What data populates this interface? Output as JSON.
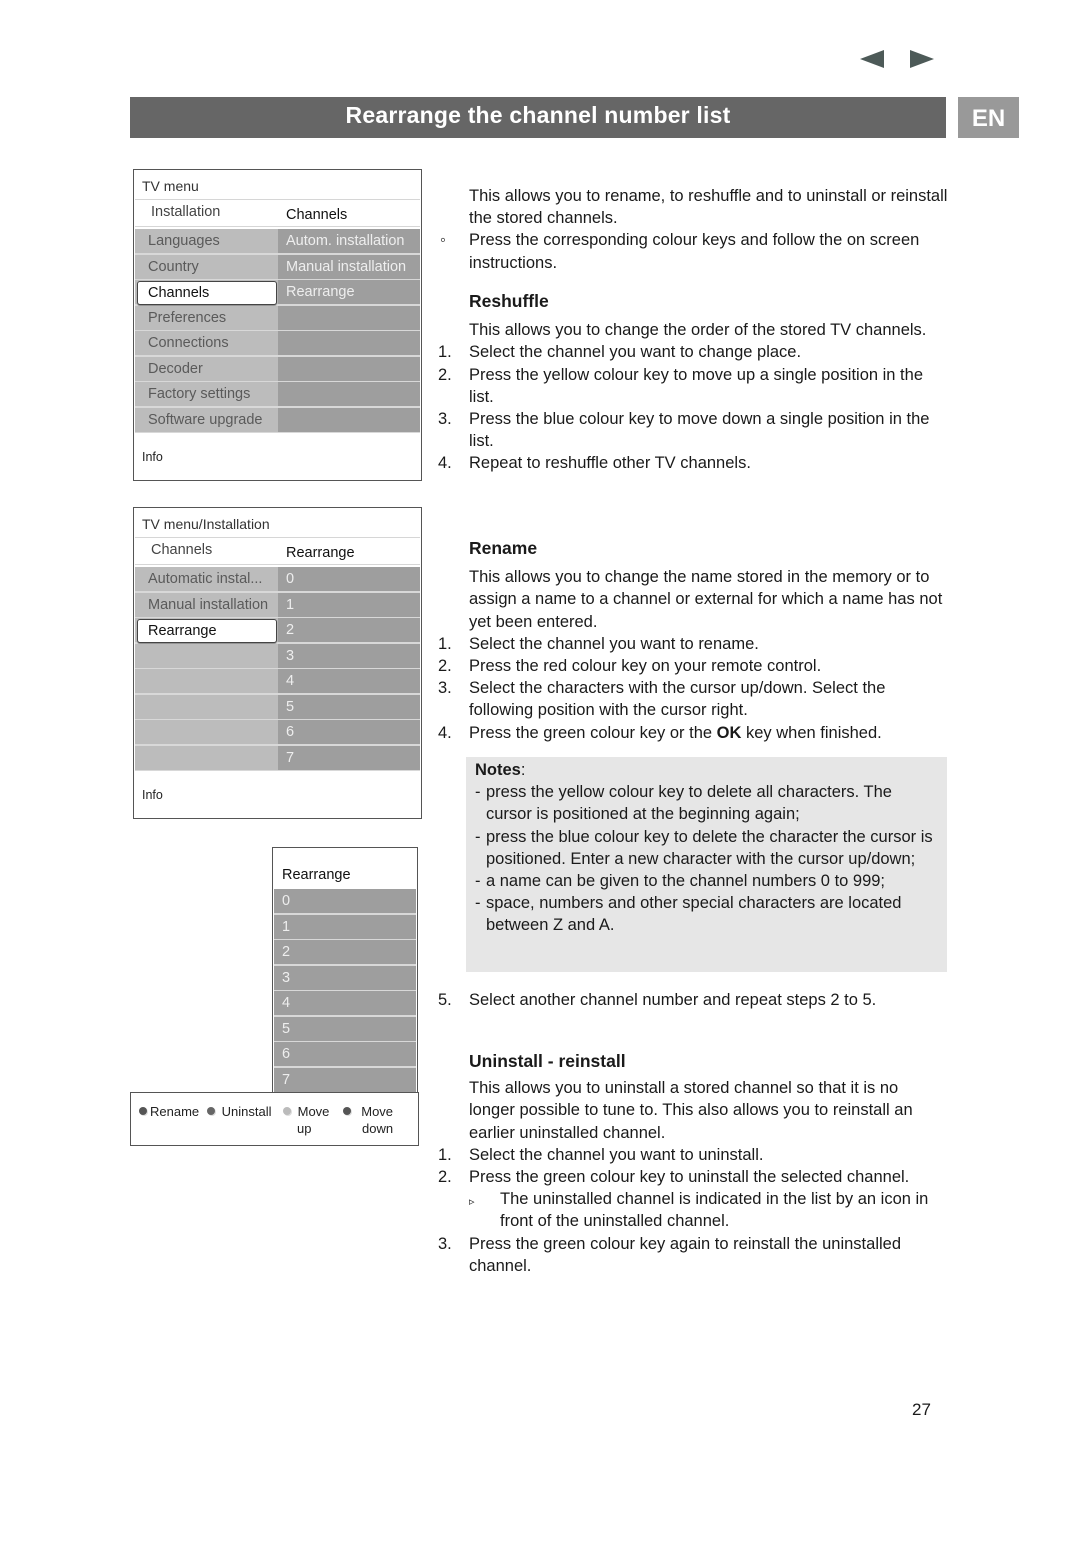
{
  "nav": {
    "prev_icon": "arrow-left-icon",
    "next_icon": "arrow-right-icon"
  },
  "header": {
    "title": "Rearrange the channel number list",
    "language": "EN"
  },
  "colors": {
    "title_bar": "#666666",
    "lang_badge": "#999999",
    "notes_bg": "#e6e6e6"
  },
  "panel1": {
    "breadcrumb": "TV menu",
    "left_header": "Installation",
    "right_header": "Channels",
    "left_items": [
      "Languages",
      "Country",
      "Channels",
      "Preferences",
      "Connections",
      "Decoder",
      "Factory settings",
      "Software upgrade"
    ],
    "right_items": [
      "Autom. installation",
      "Manual installation",
      "Rearrange",
      "",
      "",
      "",
      "",
      ""
    ],
    "selected": "Channels",
    "info": "Info"
  },
  "panel2": {
    "breadcrumb": "TV menu/Installation",
    "left_header": "Channels",
    "right_header": "Rearrange",
    "left_items": [
      "Automatic instal...",
      "Manual installation",
      "Rearrange",
      "",
      "",
      "",
      "",
      ""
    ],
    "right_items": [
      "0",
      "1",
      "2",
      "3",
      "4",
      "5",
      "6",
      "7"
    ],
    "selected": "Rearrange",
    "info": "Info"
  },
  "panel3": {
    "header": "Rearrange",
    "items": [
      "0",
      "1",
      "2",
      "3",
      "4",
      "5",
      "6",
      "7"
    ]
  },
  "legend": {
    "keys": [
      {
        "label": "Rename",
        "sub": "",
        "color": "#555555"
      },
      {
        "label": "Uninstall",
        "sub": "",
        "color": "#666666"
      },
      {
        "label": "Move",
        "sub": "up",
        "color": "#bbbbbb"
      },
      {
        "label": "Move",
        "sub": "down",
        "color": "#555555"
      }
    ]
  },
  "intro": {
    "text": "This allows you to rename, to reshuffle and to uninstall or reinstall the stored channels.",
    "bullet": "◦",
    "bullet_text": "Press the corresponding colour keys and follow the on screen instructions."
  },
  "reshuffle": {
    "heading": "Reshuffle",
    "text": "This allows you to change the order of the stored TV channels.",
    "steps": [
      {
        "n": "1.",
        "t": "Select the channel you want to change place."
      },
      {
        "n": "2.",
        "t": "Press the yellow colour key  to move up a single position in the list."
      },
      {
        "n": "3.",
        "t": "Press the blue colour key to move down a single position in the list."
      },
      {
        "n": "4.",
        "t": "Repeat to reshuffle other TV channels."
      }
    ]
  },
  "rename": {
    "heading": "Rename",
    "text": "This allows you to change the name stored in the memory or to assign a name to a channel or external for which a name has not yet been entered.",
    "steps": [
      {
        "n": "1.",
        "t": "Select the channel you want to rename."
      },
      {
        "n": "2.",
        "t": "Press the red colour key on your remote control."
      },
      {
        "n": "3.",
        "t": "Select the characters with the cursor up/down. Select the following position with the cursor right."
      },
      {
        "n": "4.",
        "pre": "Press the green colour key or the ",
        "bold": "OK",
        "post": " key when finished."
      }
    ],
    "notes_title": "Notes",
    "notes_colon": ":",
    "notes": [
      "press the yellow colour key to delete all characters. The cursor is positioned at the beginning again;",
      "press the blue colour key to delete the character the cursor is positioned. Enter a new character with the cursor up/down;",
      "a name can be given to the channel numbers 0 to 999;",
      "space, numbers and other special characters are located between Z and A."
    ],
    "step5": {
      "n": "5.",
      "t": "Select another channel number and repeat steps 2 to 5."
    }
  },
  "uninstall": {
    "heading": "Uninstall - reinstall",
    "text": "This allows you to uninstall a stored channel so that it is no longer possible to tune to. This also allows you to reinstall an earlier uninstalled channel.",
    "steps": [
      {
        "n": "1.",
        "t": "Select the channel you want to uninstall."
      },
      {
        "n": "2.",
        "t": "Press the green colour key to uninstall the selected channel."
      }
    ],
    "result_marker": "▹",
    "result": "The uninstalled channel is indicated in the list by an icon in front of the uninstalled channel.",
    "step3": {
      "n": "3.",
      "t": "Press the green colour key again to reinstall the uninstalled channel."
    }
  },
  "page_number": "27"
}
